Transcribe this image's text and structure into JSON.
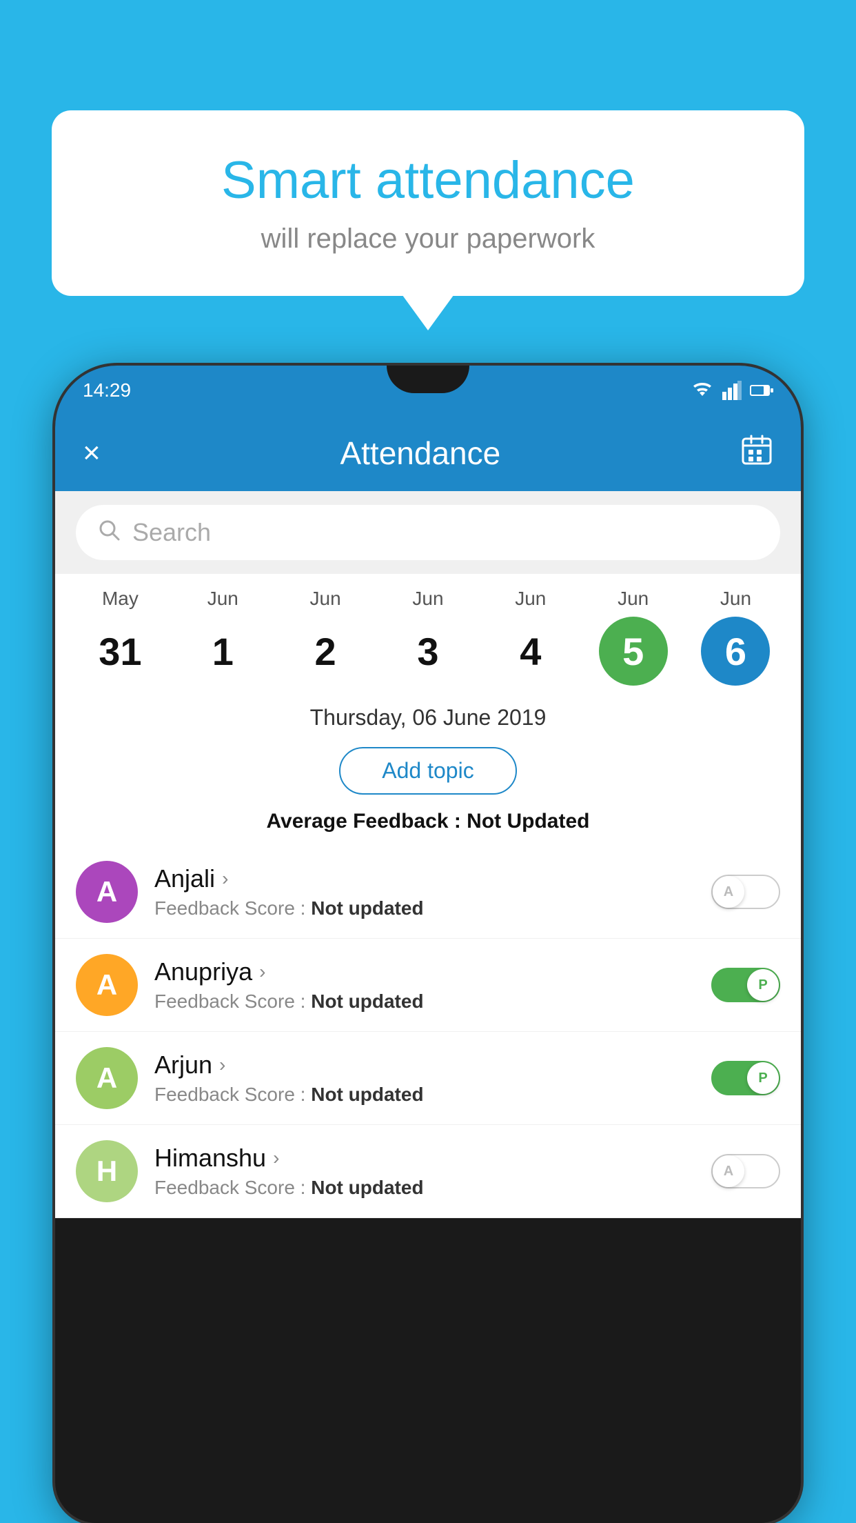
{
  "background_color": "#29b6e8",
  "hero": {
    "title": "Smart attendance",
    "subtitle": "will replace your paperwork"
  },
  "status_bar": {
    "time": "14:29",
    "wifi_icon": "wifi",
    "signal_icon": "signal",
    "battery_icon": "battery"
  },
  "app_bar": {
    "title": "Attendance",
    "close_icon": "×",
    "calendar_icon": "📅"
  },
  "search": {
    "placeholder": "Search"
  },
  "calendar": {
    "days": [
      {
        "month": "May",
        "date": "31",
        "state": "normal"
      },
      {
        "month": "Jun",
        "date": "1",
        "state": "normal"
      },
      {
        "month": "Jun",
        "date": "2",
        "state": "normal"
      },
      {
        "month": "Jun",
        "date": "3",
        "state": "normal"
      },
      {
        "month": "Jun",
        "date": "4",
        "state": "normal"
      },
      {
        "month": "Jun",
        "date": "5",
        "state": "today"
      },
      {
        "month": "Jun",
        "date": "6",
        "state": "selected"
      }
    ]
  },
  "selected_date_label": "Thursday, 06 June 2019",
  "add_topic_label": "Add topic",
  "average_feedback": {
    "label": "Average Feedback : ",
    "value": "Not Updated"
  },
  "students": [
    {
      "name": "Anjali",
      "avatar_letter": "A",
      "avatar_color": "#ab47bc",
      "feedback_label": "Feedback Score : ",
      "feedback_value": "Not updated",
      "toggle_state": "off",
      "toggle_label": "A"
    },
    {
      "name": "Anupriya",
      "avatar_letter": "A",
      "avatar_color": "#ffa726",
      "feedback_label": "Feedback Score : ",
      "feedback_value": "Not updated",
      "toggle_state": "on",
      "toggle_label": "P"
    },
    {
      "name": "Arjun",
      "avatar_letter": "A",
      "avatar_color": "#9ccc65",
      "feedback_label": "Feedback Score : ",
      "feedback_value": "Not updated",
      "toggle_state": "on",
      "toggle_label": "P"
    },
    {
      "name": "Himanshu",
      "avatar_letter": "H",
      "avatar_color": "#aed581",
      "feedback_label": "Feedback Score : ",
      "feedback_value": "Not updated",
      "toggle_state": "off",
      "toggle_label": "A"
    }
  ]
}
